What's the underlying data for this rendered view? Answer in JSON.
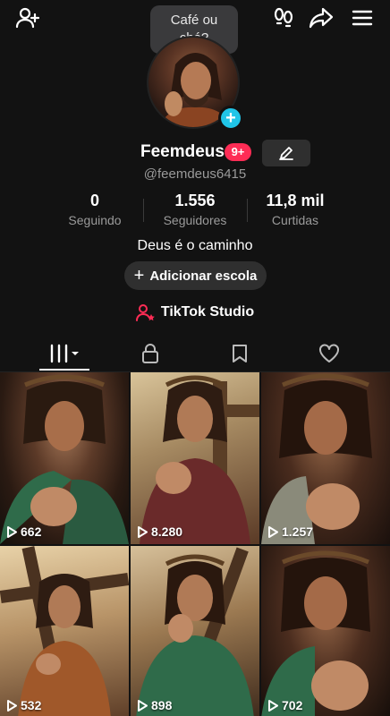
{
  "top_bar": {
    "tooltip_text": "Café ou chá?",
    "icons": [
      "add-friend-icon",
      "footprints-icon",
      "share-icon",
      "menu-icon"
    ]
  },
  "profile": {
    "username": "Feemdeus",
    "notification_count": "9+",
    "handle": "@feemdeus6415",
    "bio": "Deus é o caminho"
  },
  "stats": [
    {
      "value": "0",
      "label": "Seguindo"
    },
    {
      "value": "1.556",
      "label": "Seguidores"
    },
    {
      "value": "11,8 mil",
      "label": "Curtidas"
    }
  ],
  "actions": {
    "add_school_label": "Adicionar escola",
    "studio_label": "TikTok Studio"
  },
  "tabs": [
    {
      "name": "videos",
      "icon": "grid-icon",
      "active": true
    },
    {
      "name": "private",
      "icon": "lock-icon",
      "active": false
    },
    {
      "name": "saved",
      "icon": "bookmark-icon",
      "active": false
    },
    {
      "name": "liked",
      "icon": "heart-icon",
      "active": false
    }
  ],
  "videos": [
    {
      "views": "662"
    },
    {
      "views": "8.280"
    },
    {
      "views": "1.257"
    },
    {
      "views": "532"
    },
    {
      "views": "898"
    },
    {
      "views": "702"
    }
  ],
  "colors": {
    "background": "#121212",
    "accent_pink": "#fe2c55",
    "accent_cyan": "#20c5e8",
    "muted_text": "#9a9a9a"
  }
}
